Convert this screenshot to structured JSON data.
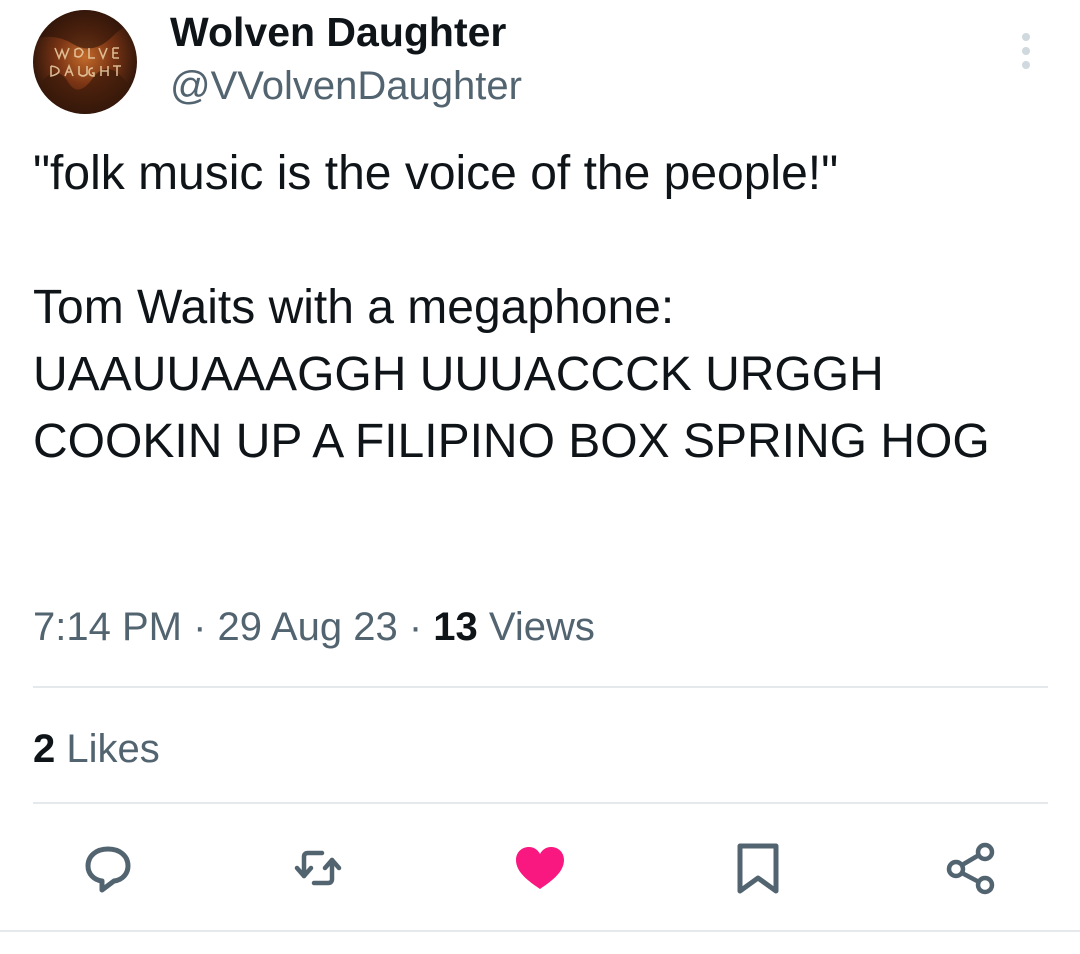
{
  "author": {
    "display_name": "Wolven Daughter",
    "handle": "@VVolvenDaughter",
    "avatar": {
      "icon": "band-logo-avatar",
      "logo_text": "WOLVEN DAUGHTER",
      "colors": [
        "#1a0e08",
        "#5a2a12",
        "#a8541e",
        "#e0a060"
      ]
    },
    "more_icon": "more-vertical-icon"
  },
  "tweet": {
    "text": "\"folk music is the voice of the people!\"\n\nTom Waits with a megaphone: UAAUUAAAGGH UUUACCCK URGGH COOKIN UP A FILIPINO BOX SPRING HOG"
  },
  "meta": {
    "time": "7:14 PM",
    "separator": " · ",
    "date": "29 Aug 23",
    "views_count": "13",
    "views_label": " Views"
  },
  "engagement": {
    "likes_count": "2",
    "likes_label": " Likes"
  },
  "actions": {
    "reply_icon": "reply-icon",
    "retweet_icon": "retweet-icon",
    "like_icon": "heart-icon",
    "bookmark_icon": "bookmark-icon",
    "share_icon": "share-icon",
    "like_active_color": "#f91880",
    "icon_color": "#536471"
  },
  "colors": {
    "text_primary": "#0f1419",
    "text_secondary": "#536471",
    "divider": "#e6e9ec"
  }
}
